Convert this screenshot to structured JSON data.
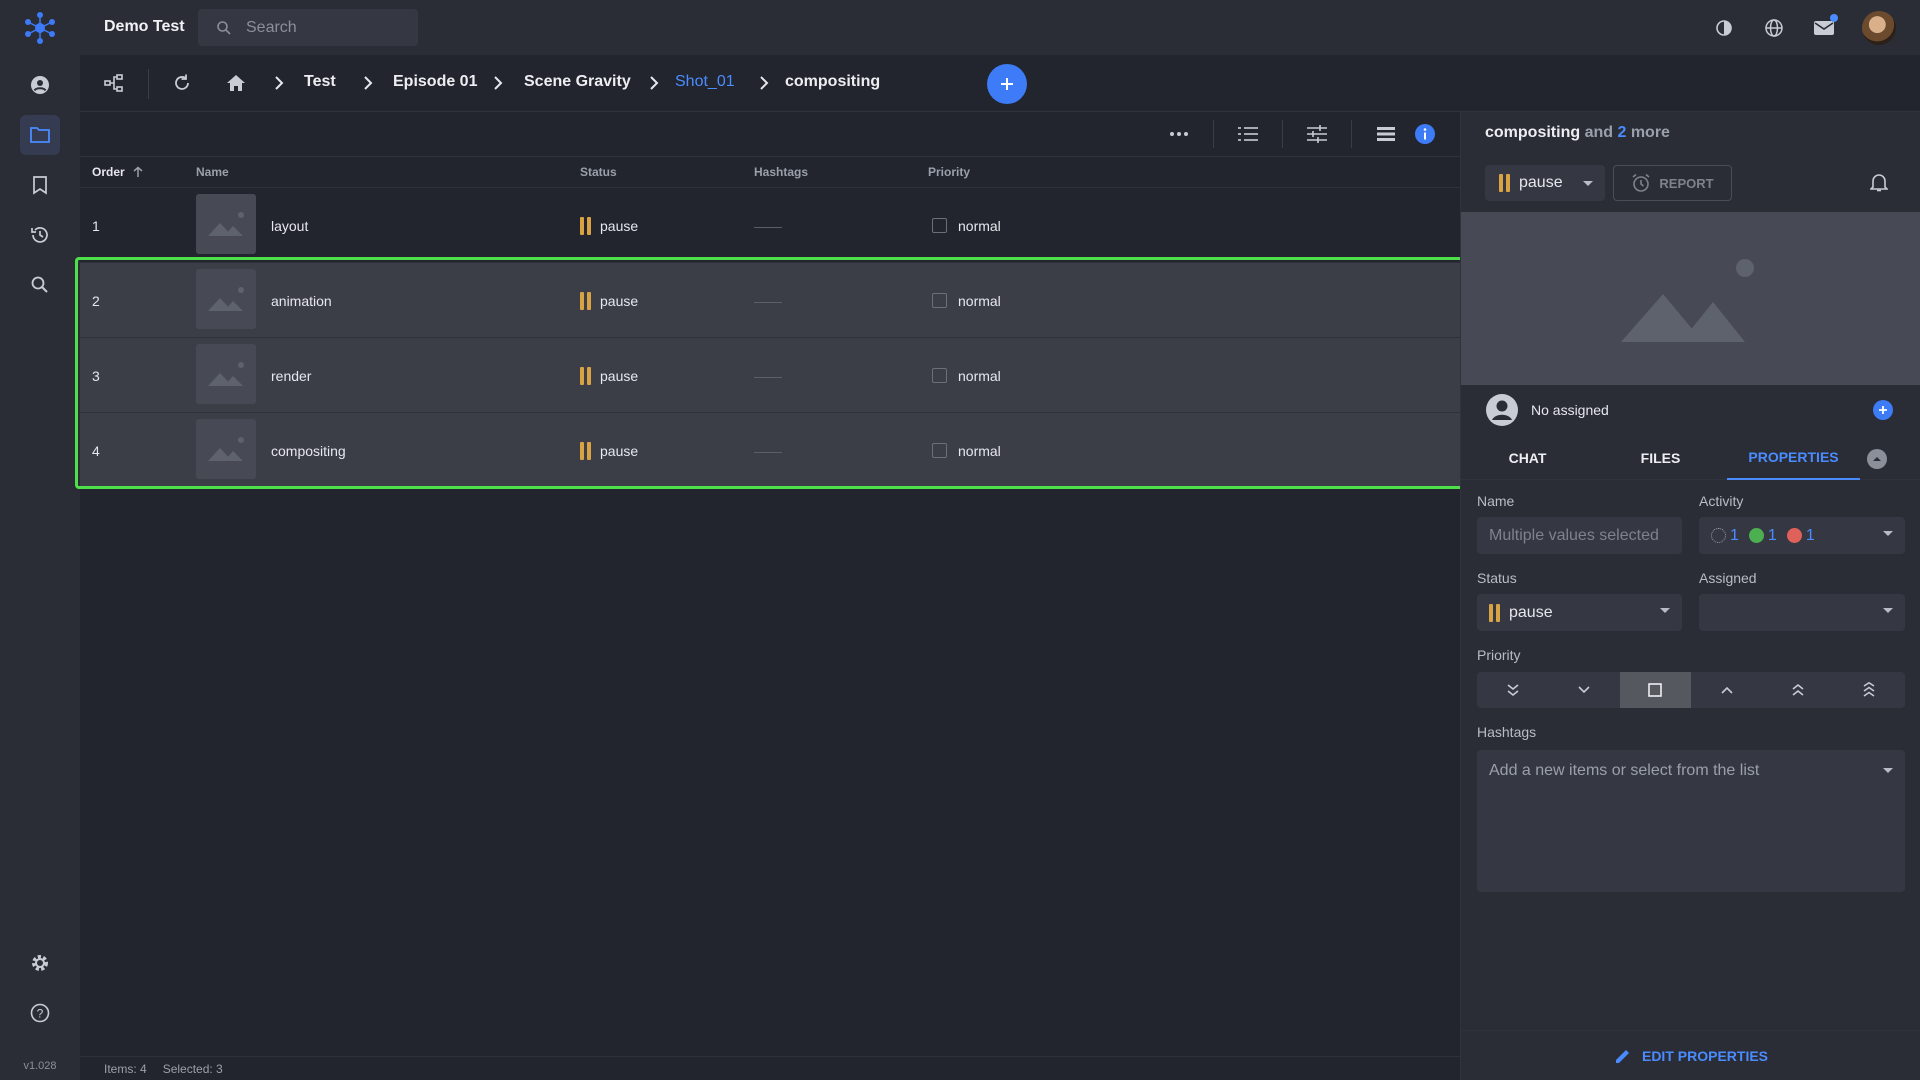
{
  "app": {
    "title": "Demo Test",
    "version": "v1.028"
  },
  "search": {
    "placeholder": "Search"
  },
  "breadcrumb": [
    "Test",
    "Episode 01",
    "Scene Gravity",
    "Shot_01",
    "compositing"
  ],
  "table": {
    "columns": [
      "Order",
      "Name",
      "Status",
      "Hashtags",
      "Priority"
    ],
    "rows": [
      {
        "order": "1",
        "name": "layout",
        "status": "pause",
        "hashtags": "——",
        "priority": "normal",
        "selected": false
      },
      {
        "order": "2",
        "name": "animation",
        "status": "pause",
        "hashtags": "——",
        "priority": "normal",
        "selected": true
      },
      {
        "order": "3",
        "name": "render",
        "status": "pause",
        "hashtags": "——",
        "priority": "normal",
        "selected": true
      },
      {
        "order": "4",
        "name": "compositing",
        "status": "pause",
        "hashtags": "——",
        "priority": "normal",
        "selected": true
      }
    ]
  },
  "statusbar": {
    "items": "Items: 4",
    "selected": "Selected: 3"
  },
  "panel": {
    "title_name": "compositing",
    "title_and": "and",
    "title_count": "2",
    "title_more": "more",
    "status": "pause",
    "report": "REPORT",
    "assigned": "No assigned",
    "tabs": [
      "CHAT",
      "FILES",
      "PROPERTIES"
    ],
    "name_label": "Name",
    "name_placeholder": "Multiple values selected",
    "activity_label": "Activity",
    "activity": [
      {
        "count": "1",
        "color": "#2a2d35"
      },
      {
        "count": "1",
        "color": "#4caf50"
      },
      {
        "count": "1",
        "color": "#e0605a"
      }
    ],
    "status_label": "Status",
    "status_value": "pause",
    "assigned_label": "Assigned",
    "priority_label": "Priority",
    "priority_selected": "normal",
    "hashtags_label": "Hashtags",
    "hashtags_placeholder": "Add a new items or select from the list",
    "edit": "EDIT PROPERTIES"
  },
  "colors": {
    "accent": "#3d7bf7",
    "pause": "#d9a243",
    "selection": "#4ee04a"
  }
}
